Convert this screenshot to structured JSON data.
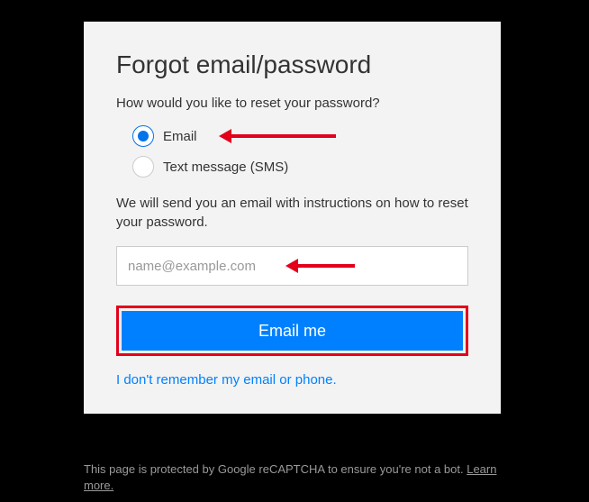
{
  "card": {
    "title": "Forgot email/password",
    "subtitle": "How would you like to reset your password?",
    "options": {
      "email": "Email",
      "sms": "Text message (SMS)"
    },
    "instructions": "We will send you an email with instructions on how to reset your password.",
    "email_placeholder": "name@example.com",
    "button_label": "Email me",
    "forgot_link": "I don't remember my email or phone."
  },
  "footer": {
    "text_prefix": "This page is protected by Google reCAPTCHA to ensure you're not a bot. ",
    "learn_more": "Learn more."
  }
}
